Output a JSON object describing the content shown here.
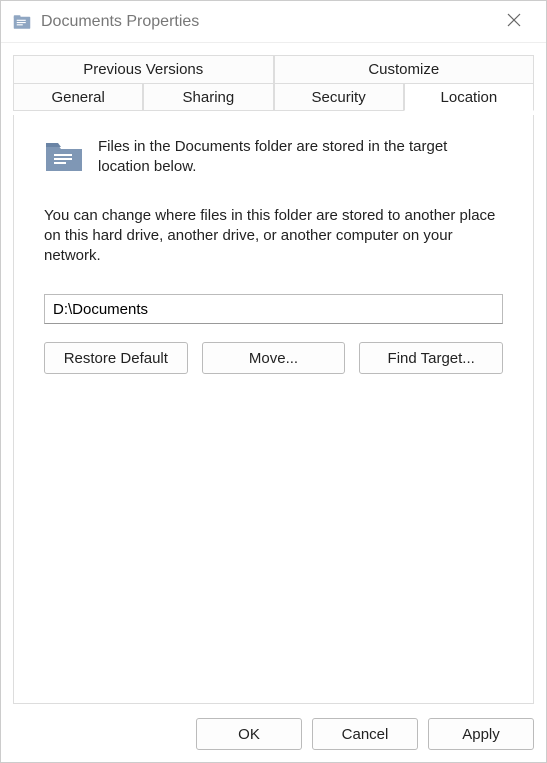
{
  "titlebar": {
    "title": "Documents Properties"
  },
  "tabs": {
    "row1": [
      {
        "label": "Previous Versions"
      },
      {
        "label": "Customize"
      }
    ],
    "row2": [
      {
        "label": "General"
      },
      {
        "label": "Sharing"
      },
      {
        "label": "Security"
      },
      {
        "label": "Location"
      }
    ]
  },
  "panel": {
    "intro": "Files in the Documents folder are stored in the target location below.",
    "description": "You can change where files in this folder are stored to another place on this hard drive, another drive, or another computer on your network.",
    "path": "D:\\Documents"
  },
  "buttons": {
    "restore": "Restore Default",
    "move": "Move...",
    "find": "Find Target...",
    "ok": "OK",
    "cancel": "Cancel",
    "apply": "Apply"
  }
}
